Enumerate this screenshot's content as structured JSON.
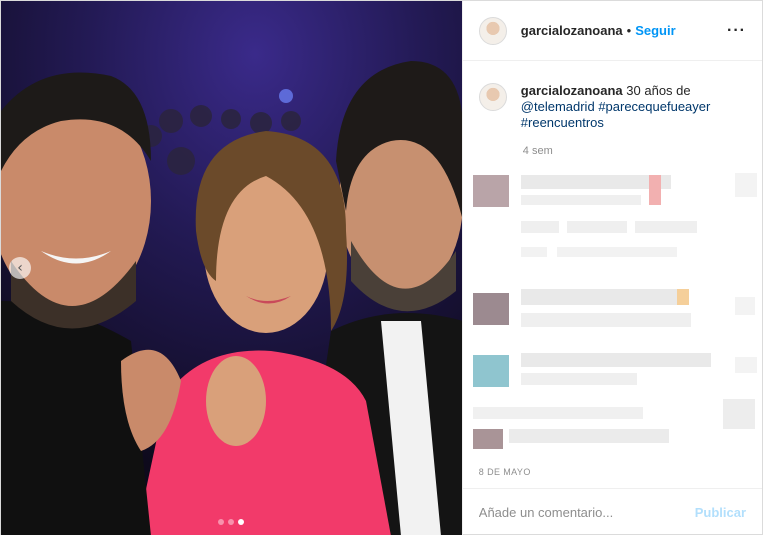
{
  "photo": {
    "prev_glyph": "‹",
    "slide_count": 3,
    "active_slide": 3
  },
  "header": {
    "username": "garcialozanoana",
    "separator": "•",
    "follow_label": "Seguir",
    "more_glyph": "···"
  },
  "caption": {
    "username": "garcialozanoana",
    "text": "30 años de",
    "tags": [
      "@telemadrid",
      "#parecequefueayer",
      "#reencuentros"
    ],
    "time_ago": "4 sem"
  },
  "comments_note": "blurred",
  "post_date": "8 DE MAYO",
  "comment_box": {
    "placeholder": "Añade un comentario...",
    "publish_label": "Publicar"
  },
  "colors": {
    "link": "#0095f6",
    "hashtag": "#00376b",
    "publish_disabled": "#b2dffc",
    "muted": "#8e8e8e"
  }
}
